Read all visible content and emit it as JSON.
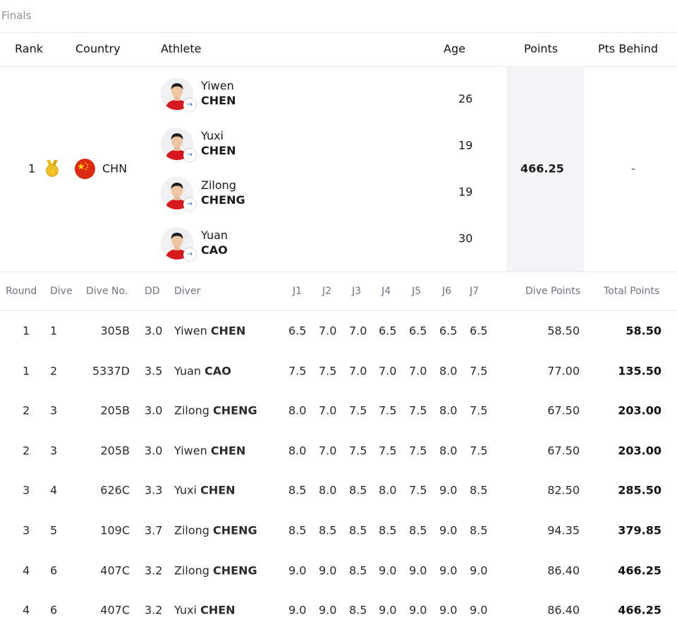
{
  "stage": "Finals",
  "result_headers": {
    "rank": "Rank",
    "country": "Country",
    "athlete": "Athlete",
    "age": "Age",
    "points": "Points",
    "pts_behind": "Pts Behind"
  },
  "result": {
    "rank": "1",
    "medal_icon": "gold-medal-icon",
    "country_code": "CHN",
    "flag_colors": {
      "field": "#de2910",
      "stars": "#ffde00"
    },
    "points": "466.25",
    "pts_behind": "-",
    "athletes": [
      {
        "first": "Yiwen",
        "last": "CHEN",
        "age": "26"
      },
      {
        "first": "Yuxi",
        "last": "CHEN",
        "age": "19"
      },
      {
        "first": "Zilong",
        "last": "CHENG",
        "age": "19"
      },
      {
        "first": "Yuan",
        "last": "CAO",
        "age": "30"
      }
    ]
  },
  "dive_headers": {
    "round": "Round",
    "dive": "Dive",
    "dive_no": "Dive No.",
    "dd": "DD",
    "diver": "Diver",
    "j1": "J1",
    "j2": "J2",
    "j3": "J3",
    "j4": "J4",
    "j5": "J5",
    "j6": "J6",
    "j7": "J7",
    "dive_points": "Dive Points",
    "total_points": "Total Points"
  },
  "dives": [
    {
      "round": "1",
      "dive": "1",
      "dive_no": "305B",
      "dd": "3.0",
      "first": "Yiwen",
      "last": "CHEN",
      "j1": "6.5",
      "j2": "7.0",
      "j3": "7.0",
      "j4": "6.5",
      "j5": "6.5",
      "j6": "6.5",
      "j7": "6.5",
      "dive_points": "58.50",
      "total_points": "58.50"
    },
    {
      "round": "1",
      "dive": "2",
      "dive_no": "5337D",
      "dd": "3.5",
      "first": "Yuan",
      "last": "CAO",
      "j1": "7.5",
      "j2": "7.5",
      "j3": "7.0",
      "j4": "7.0",
      "j5": "7.0",
      "j6": "8.0",
      "j7": "7.5",
      "dive_points": "77.00",
      "total_points": "135.50"
    },
    {
      "round": "2",
      "dive": "3",
      "dive_no": "205B",
      "dd": "3.0",
      "first": "Zilong",
      "last": "CHENG",
      "j1": "8.0",
      "j2": "7.0",
      "j3": "7.5",
      "j4": "7.5",
      "j5": "7.5",
      "j6": "8.0",
      "j7": "7.5",
      "dive_points": "67.50",
      "total_points": "203.00"
    },
    {
      "round": "2",
      "dive": "3",
      "dive_no": "205B",
      "dd": "3.0",
      "first": "Yiwen",
      "last": "CHEN",
      "j1": "8.0",
      "j2": "7.0",
      "j3": "7.5",
      "j4": "7.5",
      "j5": "7.5",
      "j6": "8.0",
      "j7": "7.5",
      "dive_points": "67.50",
      "total_points": "203.00"
    },
    {
      "round": "3",
      "dive": "4",
      "dive_no": "626C",
      "dd": "3.3",
      "first": "Yuxi",
      "last": "CHEN",
      "j1": "8.5",
      "j2": "8.0",
      "j3": "8.5",
      "j4": "8.0",
      "j5": "7.5",
      "j6": "9.0",
      "j7": "8.5",
      "dive_points": "82.50",
      "total_points": "285.50"
    },
    {
      "round": "3",
      "dive": "5",
      "dive_no": "109C",
      "dd": "3.7",
      "first": "Zilong",
      "last": "CHENG",
      "j1": "8.5",
      "j2": "8.5",
      "j3": "8.5",
      "j4": "8.5",
      "j5": "8.5",
      "j6": "9.0",
      "j7": "8.5",
      "dive_points": "94.35",
      "total_points": "379.85"
    },
    {
      "round": "4",
      "dive": "6",
      "dive_no": "407C",
      "dd": "3.2",
      "first": "Zilong",
      "last": "CHENG",
      "j1": "9.0",
      "j2": "9.0",
      "j3": "8.5",
      "j4": "9.0",
      "j5": "9.0",
      "j6": "9.0",
      "j7": "9.0",
      "dive_points": "86.40",
      "total_points": "466.25"
    },
    {
      "round": "4",
      "dive": "6",
      "dive_no": "407C",
      "dd": "3.2",
      "first": "Yuxi",
      "last": "CHEN",
      "j1": "9.0",
      "j2": "9.0",
      "j3": "8.5",
      "j4": "9.0",
      "j5": "9.0",
      "j6": "9.0",
      "j7": "9.0",
      "dive_points": "86.40",
      "total_points": "466.25"
    }
  ]
}
